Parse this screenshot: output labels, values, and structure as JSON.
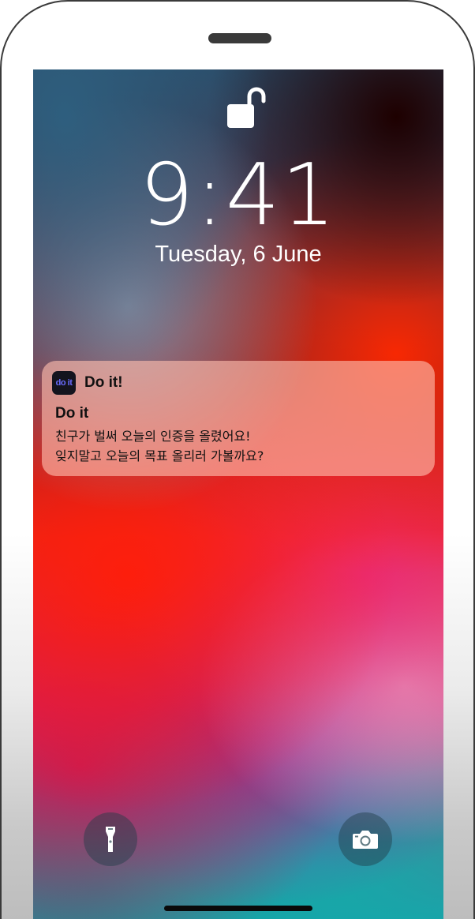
{
  "lock_screen": {
    "time": "9:41",
    "date": "Tuesday, 6 June",
    "lock_icon": "unlocked-padlock-icon"
  },
  "notification": {
    "app_icon_text": "do it",
    "app_icon_color": "#6a6cff",
    "app_name": "Do it!",
    "title": "Do it",
    "body_lines": [
      "친구가 벌써 오늘의 인증을 올렸어요!",
      "잊지말고 오늘의 목표 올리러 가볼까요?"
    ]
  },
  "quick_actions": {
    "left": "flashlight-icon",
    "right": "camera-icon"
  }
}
